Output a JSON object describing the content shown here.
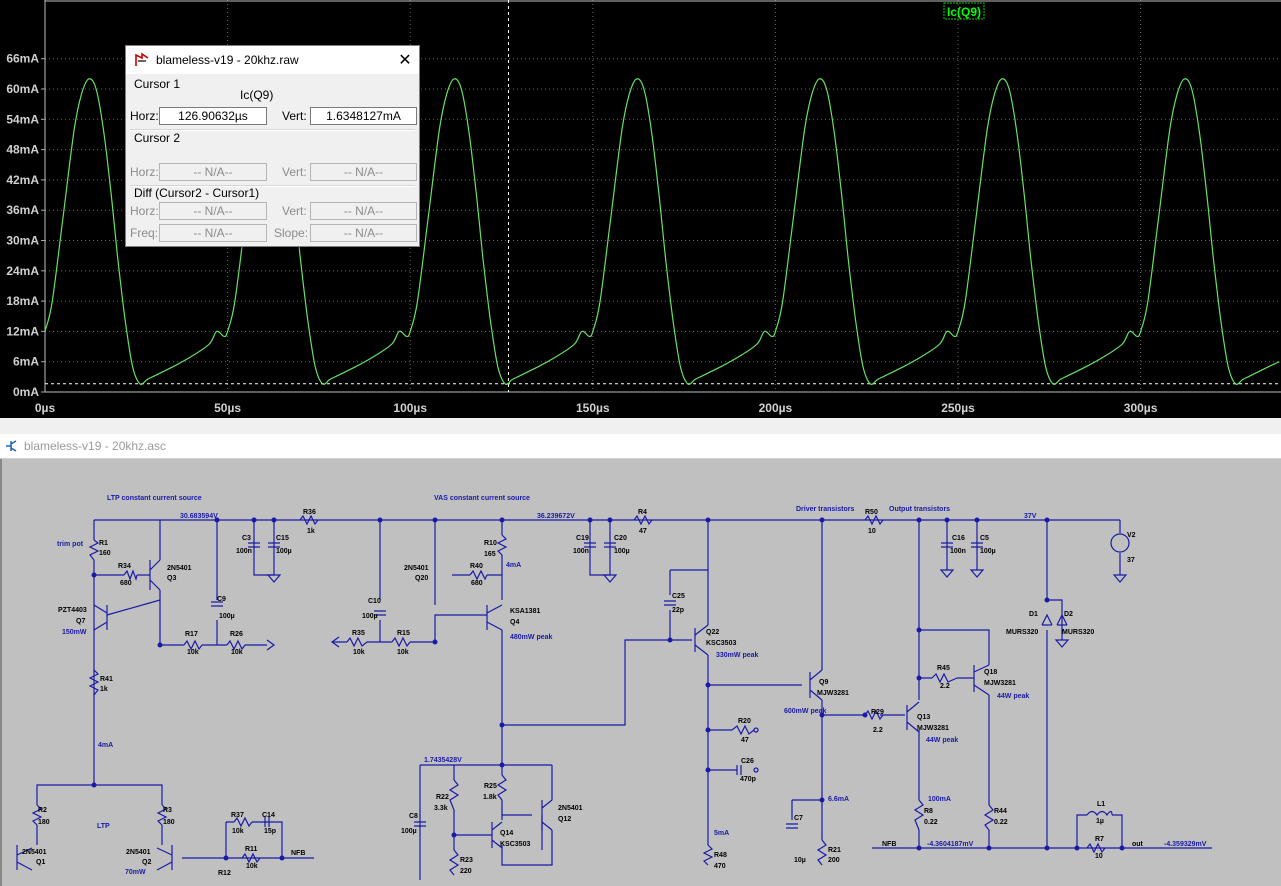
{
  "waveform": {
    "trace_label": "Ic(Q9)",
    "trace_color": "#66e066",
    "label_color": "#00ff00",
    "y_tick_labels": [
      "66mA",
      "60mA",
      "54mA",
      "48mA",
      "42mA",
      "36mA",
      "30mA",
      "24mA",
      "18mA",
      "12mA",
      "6mA",
      "0mA"
    ],
    "x_tick_labels": [
      "0µs",
      "50µs",
      "100µs",
      "150µs",
      "200µs",
      "250µs",
      "300µs"
    ],
    "chart_data": {
      "type": "line",
      "xlabel": "",
      "ylabel": "",
      "x_unit": "µs",
      "y_unit": "mA",
      "xlim": [
        0,
        338
      ],
      "ylim": [
        0,
        66
      ],
      "grid": true,
      "series": [
        {
          "name": "Ic(Q9)",
          "period_us": 50,
          "x": [
            0,
            2,
            5,
            8,
            10,
            12,
            14,
            16,
            18,
            20,
            22,
            24,
            26,
            28,
            30,
            35,
            40,
            45,
            47,
            49,
            50,
            52,
            55,
            58,
            60,
            62,
            64,
            66,
            68,
            70,
            72,
            74,
            76,
            78,
            80,
            85,
            90,
            95,
            97,
            99,
            100,
            102,
            105,
            108,
            110,
            112,
            114,
            116,
            118,
            120,
            122,
            124,
            126,
            128,
            130,
            135,
            140,
            145,
            147,
            149,
            150,
            152,
            155,
            158,
            160,
            162,
            164,
            166,
            168,
            170,
            172,
            174,
            176,
            178,
            180,
            185,
            190,
            195,
            197,
            199,
            200,
            202,
            205,
            208,
            210,
            212,
            214,
            216,
            218,
            220,
            222,
            224,
            226,
            228,
            230,
            235,
            240,
            245,
            247,
            249,
            250,
            252,
            255,
            258,
            260,
            262,
            264,
            266,
            268,
            270,
            272,
            274,
            276,
            278,
            280,
            285,
            290,
            295,
            297,
            299,
            300,
            302,
            305,
            308,
            310,
            312,
            314,
            316,
            318,
            320,
            322,
            324,
            326,
            328,
            330,
            335,
            338
          ],
          "y": [
            12,
            18,
            35,
            52,
            59,
            62,
            60,
            52,
            40,
            26,
            14,
            5,
            1.6,
            2.5,
            3.2,
            5,
            7,
            9.5,
            12,
            11,
            12,
            18,
            35,
            52,
            59,
            62,
            60,
            52,
            40,
            26,
            14,
            5,
            1.6,
            2.5,
            3.2,
            5,
            7,
            9.5,
            12,
            11,
            12,
            18,
            35,
            52,
            59,
            62,
            60,
            52,
            40,
            26,
            14,
            5,
            1.6,
            2.5,
            3.2,
            5,
            7,
            9.5,
            12,
            11,
            12,
            18,
            35,
            52,
            59,
            62,
            60,
            52,
            40,
            26,
            14,
            5,
            1.6,
            2.5,
            3.2,
            5,
            7,
            9.5,
            12,
            11,
            12,
            18,
            35,
            52,
            59,
            62,
            60,
            52,
            40,
            26,
            14,
            5,
            1.6,
            2.5,
            3.2,
            5,
            7,
            9.5,
            12,
            11,
            12,
            18,
            35,
            52,
            59,
            62,
            60,
            52,
            40,
            26,
            14,
            5,
            1.6,
            2.5,
            3.2,
            5,
            7,
            9.5,
            12,
            11,
            12,
            18,
            35,
            52,
            59,
            62,
            60,
            52,
            40,
            26,
            14,
            5,
            1.6,
            2.5,
            3.2,
            5,
            6
          ]
        }
      ],
      "cursor_lines": [
        {
          "orientation": "vertical",
          "x": 126.90632
        },
        {
          "orientation": "horizontal",
          "y": 1.6348127
        }
      ]
    }
  },
  "cursor_dialog": {
    "title": "blameless-v19 - 20khz.raw",
    "close_glyph": "✕",
    "cursor1_heading": "Cursor 1",
    "trace_name": "Ic(Q9)",
    "horz_label": "Horz:",
    "vert_label": "Vert:",
    "cursor1_horz": "126.90632µs",
    "cursor1_vert": "1.6348127mA",
    "cursor2_heading": "Cursor 2",
    "cursor2_horz": "-- N/A--",
    "cursor2_vert": "-- N/A--",
    "diff_heading": "Diff (Cursor2 - Cursor1)",
    "diff_horz": "-- N/A--",
    "diff_vert": "-- N/A--",
    "freq_label": "Freq:",
    "slope_label": "Slope:",
    "diff_freq": "-- N/A--",
    "diff_slope": "-- N/A--"
  },
  "schematic_window": {
    "title": "blameless-v19 - 20khz.asc"
  },
  "schematic": {
    "wire_color": "#1a1aa6",
    "labels": {
      "ltp_ccs": "LTP constant current source",
      "vas_ccs": "VAS constant current source",
      "driver": "Driver transistors",
      "output": "Output transistors",
      "v_ltp": "30.683594V",
      "v_vas": "36.239672V",
      "v_rail": "37V",
      "v_mirror": "1.7435428V",
      "trim_pot": "trim pot",
      "q7_type": "PZT4403",
      "q7_name": "Q7",
      "q7_power": "150mW",
      "r1": "R1",
      "r1v": "160",
      "r34": "R34",
      "r34v": "680",
      "q3_type": "2N5401",
      "q3": "Q3",
      "c9": "C9",
      "c9v": "100µ",
      "r17": "R17",
      "r17v": "10k",
      "r26": "R26",
      "r26v": "10k",
      "c3": "C3",
      "c3v": "100n",
      "c15": "C15",
      "c15v": "100µ",
      "r36": "R36",
      "r36v": "1k",
      "r41": "R41",
      "r41v": "1k",
      "i_4ma": "4mA",
      "r2": "R2",
      "r2v": "180",
      "r3": "R3",
      "r3v": "180",
      "ltp": "LTP",
      "q1_type": "2N5401",
      "q1": "Q1",
      "q2_type": "2N5401",
      "q2": "Q2",
      "q2_power": "70mW",
      "r37": "R37",
      "r37v": "10k",
      "c14": "C14",
      "c14v": "15p",
      "r11": "R11",
      "r11v": "10k",
      "r12": "R12",
      "nfb": "NFB",
      "c10": "C10",
      "c10v": "100µ",
      "r35": "R35",
      "r35v": "10k",
      "r15": "R15",
      "r15v": "10k",
      "q20_type": "2N5401",
      "q20": "Q20",
      "r40": "R40",
      "r40v": "680",
      "r10": "R10",
      "r10v": "165",
      "i_4ma_b": "4mA",
      "q4_type": "KSA1381",
      "q4": "Q4",
      "q4_power": "480mW peak",
      "c19": "C19",
      "c19v": "100n",
      "c20": "C20",
      "c20v": "100µ",
      "r4": "R4",
      "r4v": "47",
      "c25": "C25",
      "c25v": "22p",
      "q22": "Q22",
      "q22_type": "KSC3503",
      "q22_power": "330mW peak",
      "r20": "R20",
      "r20v": "47",
      "c26": "C26",
      "c26v": "470p",
      "i_5ma": "5mA",
      "r48": "R48",
      "r48v": "470",
      "c8": "C8",
      "c8v": "100µ",
      "r22": "R22",
      "r22v": "3.3k",
      "r25": "R25",
      "r25v": "1.8k",
      "r23": "R23",
      "r23v": "220",
      "q14": "Q14",
      "q14_type": "KSC3503",
      "q12_type": "2N5401",
      "q12": "Q12",
      "r50": "R50",
      "r50v": "10",
      "q9": "Q9",
      "q9_type": "MJW3281",
      "q9_power": "600mW peak",
      "r29": "R29",
      "r29v": "2.2",
      "q13": "Q13",
      "q13_type": "MJW3281",
      "q13_power": "44W peak",
      "r45": "R45",
      "r45v": "2.2",
      "q18": "Q18",
      "q18_type": "MJW3281",
      "q18_power": "44W peak",
      "i_66ma": "6.6mA",
      "c7": "C7",
      "c7v": "10µ",
      "r21": "R21",
      "r21v": "200",
      "i_100ma": "100mA",
      "r8": "R8",
      "r8v": "0.22",
      "r44": "R44",
      "r44v": "0.22",
      "c16": "C16",
      "c16v": "100n",
      "c5": "C5",
      "c5v": "100µ",
      "v2": "V2",
      "v2v": "37",
      "d1": "D1",
      "d1_type": "MURS320",
      "d2": "D2",
      "d2_type": "MURS320",
      "l1": "L1",
      "l1v": "1µ",
      "r7": "R7",
      "r7v": "10",
      "nfb2": "NFB",
      "v_nfb": "-4.3604187mV",
      "out": "out",
      "v_out": "-4.359329mV"
    }
  }
}
